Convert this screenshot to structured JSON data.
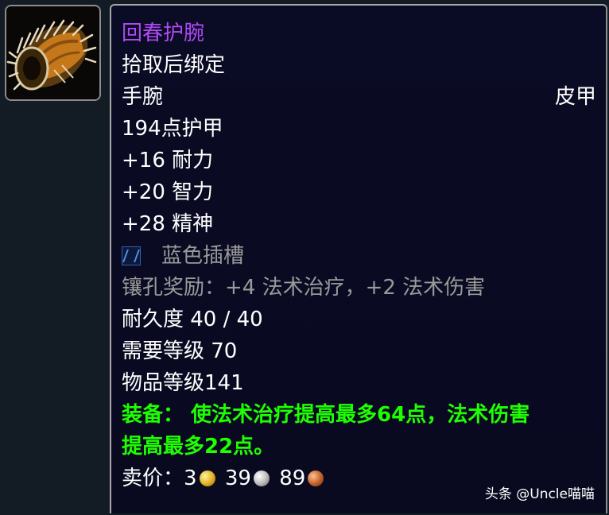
{
  "item": {
    "name": "回春护腕",
    "binding": "拾取后绑定",
    "slot": "手腕",
    "armor_type": "皮甲",
    "armor": "194点护甲",
    "stats": [
      "+16 耐力",
      "+20 智力",
      "+28 精神"
    ],
    "socket": "蓝色插槽",
    "socket_bonus": "镶孔奖励：+4 法术治疗，+2 法术伤害",
    "durability": "耐久度 40 / 40",
    "required_level": "需要等级 70",
    "item_level": "物品等级141",
    "equip_line1": "装备： 使法术治疗提高最多64点，法术伤害",
    "equip_line2": "提高最多22点。",
    "sell_label": "卖价：",
    "gold": "3",
    "silver": "39",
    "copper": "89"
  },
  "watermark": "头条 @Uncle喵喵",
  "icons": {
    "item_icon": "bracer-icon",
    "socket_icon": "blue-socket-icon",
    "gold_icon": "gold-coin-icon",
    "silver_icon": "silver-coin-icon",
    "copper_icon": "copper-coin-icon"
  },
  "colors": {
    "epic_name": "#b049f5",
    "uncommon_green": "#1eff00",
    "gray_text": "#9a9a9a",
    "tooltip_bg": "#0a0b24"
  }
}
